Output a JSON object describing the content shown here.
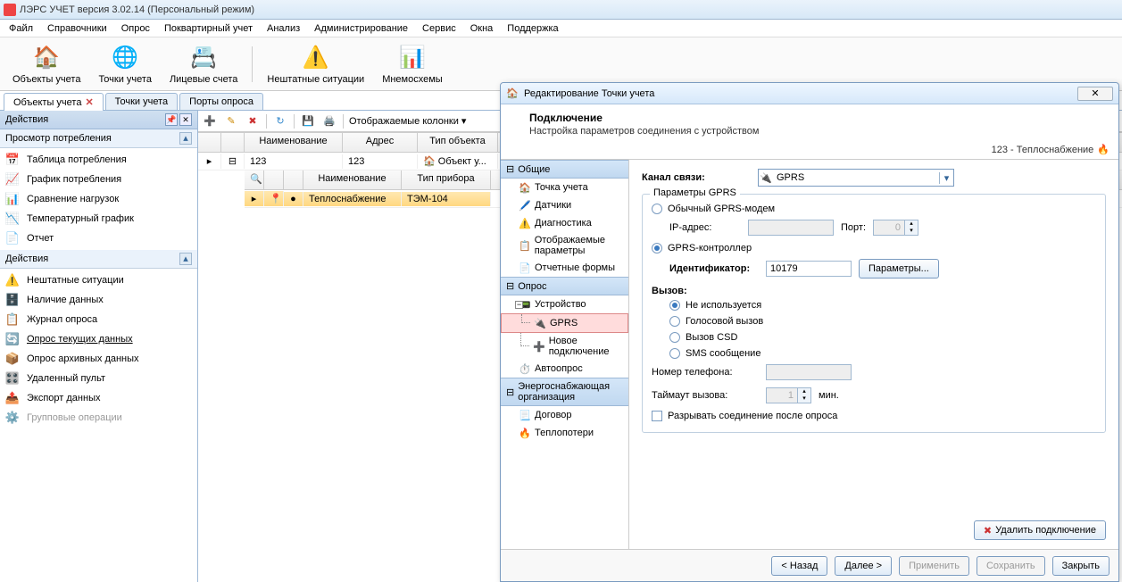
{
  "title": "ЛЭРС УЧЕТ версия 3.02.14 (Персональный режим)",
  "menu": [
    "Файл",
    "Справочники",
    "Опрос",
    "Поквартирный учет",
    "Анализ",
    "Администрирование",
    "Сервис",
    "Окна",
    "Поддержка"
  ],
  "toolbar": [
    {
      "label": "Объекты учета",
      "icon": "🏠"
    },
    {
      "label": "Точки учета",
      "icon": "🌐"
    },
    {
      "label": "Лицевые счета",
      "icon": "📇"
    },
    {
      "label": "Нештатные ситуации",
      "icon": "⚠️"
    },
    {
      "label": "Мнемосхемы",
      "icon": "📊"
    }
  ],
  "tabs": [
    {
      "label": "Объекты учета",
      "closable": true,
      "active": true
    },
    {
      "label": "Точки учета"
    },
    {
      "label": "Порты опроса"
    }
  ],
  "left": {
    "actions_title": "Действия",
    "view_title": "Просмотр потребления",
    "view_items": [
      {
        "icon": "📅",
        "label": "Таблица потребления"
      },
      {
        "icon": "📈",
        "label": "График потребления"
      },
      {
        "icon": "📊",
        "label": "Сравнение нагрузок"
      },
      {
        "icon": "📉",
        "label": "Температурный график"
      },
      {
        "icon": "📄",
        "label": "Отчет"
      }
    ],
    "actions2_title": "Действия",
    "actions2_items": [
      {
        "icon": "⚠️",
        "label": "Нештатные ситуации"
      },
      {
        "icon": "🗄️",
        "label": "Наличие данных"
      },
      {
        "icon": "📋",
        "label": "Журнал опроса"
      },
      {
        "icon": "🔄",
        "label": "Опрос текущих данных",
        "underline": true
      },
      {
        "icon": "📦",
        "label": "Опрос архивных данных"
      },
      {
        "icon": "🎛️",
        "label": "Удаленный пульт"
      },
      {
        "icon": "📤",
        "label": "Экспорт данных"
      },
      {
        "icon": "⚙️",
        "label": "Групповые операции",
        "disabled": true
      }
    ]
  },
  "grid": {
    "toolbar_label": "Отображаемые колонки",
    "cols": [
      "Наименование",
      "Адрес",
      "Тип объекта"
    ],
    "row": {
      "name": "123",
      "addr": "123",
      "type": "Объект у..."
    },
    "sub_cols": [
      "Наименование",
      "Тип прибора"
    ],
    "sub_row": {
      "name": "Теплоснабжение",
      "type": "ТЭМ-104"
    }
  },
  "dialog": {
    "title": "Редактирование Точки учета",
    "heading": "Подключение",
    "subheading": "Настройка параметров соединения с устройством",
    "crumb": "123 - Теплоснабжение",
    "tree": {
      "sec1": "Общие",
      "items1": [
        "Точка учета",
        "Датчики",
        "Диагностика",
        "Отображаемые параметры",
        "Отчетные формы"
      ],
      "sec2": "Опрос",
      "device": "Устройство",
      "gprs": "GPRS",
      "newconn": "Новое подключение",
      "autopoll": "Автоопрос",
      "sec3": "Энергоснабжающая организация",
      "contract": "Договор",
      "heatloss": "Теплопотери"
    },
    "form": {
      "channel_label": "Канал связи:",
      "channel_value": "GPRS",
      "params_legend": "Параметры GPRS",
      "radio_modem": "Обычный GPRS-модем",
      "ip_label": "IP-адрес:",
      "port_label": "Порт:",
      "port_value": "0",
      "radio_controller": "GPRS-контроллер",
      "id_label": "Идентификатор:",
      "id_value": "10179",
      "params_btn": "Параметры...",
      "call_label": "Вызов:",
      "call_opts": [
        "Не используется",
        "Голосовой вызов",
        "Вызов CSD",
        "SMS сообщение"
      ],
      "phone_label": "Номер телефона:",
      "timeout_label": "Таймаут вызова:",
      "timeout_value": "1",
      "timeout_unit": "мин.",
      "disconnect": "Разрывать соединение после опроса",
      "delete_btn": "Удалить подключение"
    },
    "footer": {
      "back": "< Назад",
      "next": "Далее >",
      "apply": "Применить",
      "save": "Сохранить",
      "close": "Закрыть"
    }
  }
}
